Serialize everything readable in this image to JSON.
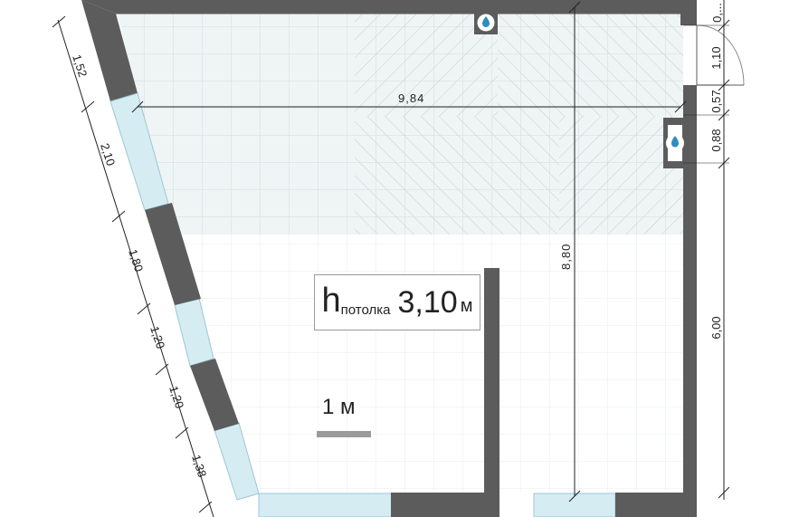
{
  "plan": {
    "ceiling_height": {
      "prefix": "h",
      "subscript": "потолка",
      "value": "3,10",
      "unit": "м"
    },
    "scale": {
      "label": "1 м"
    },
    "dimensions": {
      "length_top": "9,84",
      "length_vertical": "8,80",
      "left_1": "1,52",
      "left_2": "2,10",
      "left_3": "1,80",
      "left_4": "1,20",
      "left_5": "1,20",
      "left_6": "1,38",
      "right_0": "0,...",
      "right_1": "1,10",
      "right_2": "0,57",
      "right_3": "0,88",
      "right_4": "6,00"
    },
    "utilities": [
      {
        "icon": "water-drop-icon",
        "label": ""
      },
      {
        "icon": "water-drop-icon",
        "label": ""
      }
    ],
    "colors": {
      "wall": "#5c5c5c",
      "window": "#d5ecf3",
      "tile_zone": "#eff4f4",
      "grid_line": "#d2dede",
      "hatch_line": "#cccccc",
      "dimension_line": "#222222",
      "drop_fill": "#2d8dbf"
    }
  }
}
